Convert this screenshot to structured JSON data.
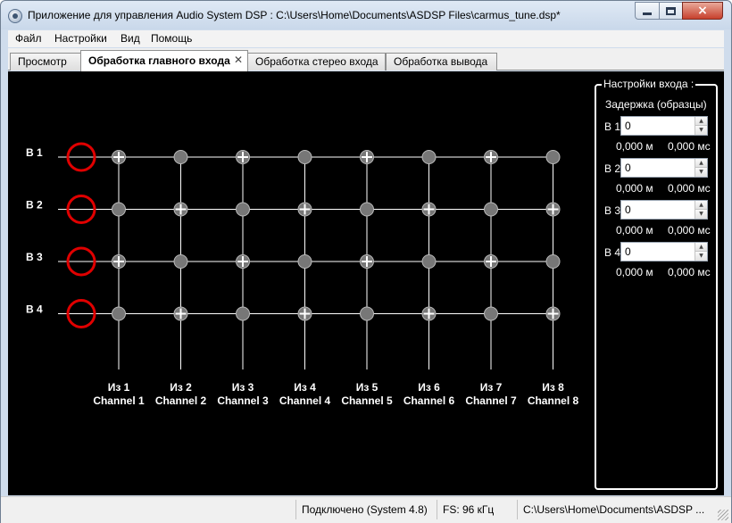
{
  "window": {
    "title": "Приложение для управления Audio System DSP : C:\\Users\\Home\\Documents\\ASDSP Files\\carmus_tune.dsp*",
    "close_glyph": "×"
  },
  "menu": [
    "Файл",
    "Настройки",
    "Вид",
    "Помощь"
  ],
  "tabs": [
    {
      "label": "Просмотр",
      "active": false
    },
    {
      "label": "Обработка главного входа",
      "active": true,
      "close": "✕"
    },
    {
      "label": "Обработка стерео входа",
      "active": false
    },
    {
      "label": "Обработка вывода",
      "active": false
    }
  ],
  "matrix": {
    "inputs": [
      "В 1",
      "В 2",
      "В 3",
      "В 4"
    ],
    "outputs": [
      {
        "from": "Из 1",
        "channel": "Channel 1"
      },
      {
        "from": "Из 2",
        "channel": "Channel 2"
      },
      {
        "from": "Из 3",
        "channel": "Channel 3"
      },
      {
        "from": "Из 4",
        "channel": "Channel 4"
      },
      {
        "from": "Из 5",
        "channel": "Channel 5"
      },
      {
        "from": "Из 6",
        "channel": "Channel 6"
      },
      {
        "from": "Из 7",
        "channel": "Channel 7"
      },
      {
        "from": "Из 8",
        "channel": "Channel 8"
      }
    ],
    "routing": [
      [
        true,
        false,
        true,
        false,
        true,
        false,
        true,
        false
      ],
      [
        false,
        true,
        false,
        true,
        false,
        true,
        false,
        true
      ],
      [
        true,
        false,
        true,
        false,
        true,
        false,
        true,
        false
      ],
      [
        false,
        true,
        false,
        true,
        false,
        true,
        false,
        true
      ]
    ],
    "colors": {
      "ring": "#e00000",
      "node": "#777777",
      "line": "#ffffff",
      "background": "#000000"
    }
  },
  "input_settings": {
    "title": "Настройки входа :",
    "delay_label": "Задержка (образцы)",
    "spin_up": "▲",
    "spin_down": "▼",
    "rows": [
      {
        "label": "В 1",
        "value": "0",
        "meters": "0,000 м",
        "ms": "0,000 мс"
      },
      {
        "label": "В 2",
        "value": "0",
        "meters": "0,000 м",
        "ms": "0,000 мс"
      },
      {
        "label": "В 3",
        "value": "0",
        "meters": "0,000 м",
        "ms": "0,000 мс"
      },
      {
        "label": "В 4",
        "value": "0",
        "meters": "0,000 м",
        "ms": "0,000 мс"
      }
    ]
  },
  "status": {
    "connection": "Подключено  (System 4.8)",
    "fs": "FS: 96 кГц",
    "path": "C:\\Users\\Home\\Documents\\ASDSP ..."
  }
}
